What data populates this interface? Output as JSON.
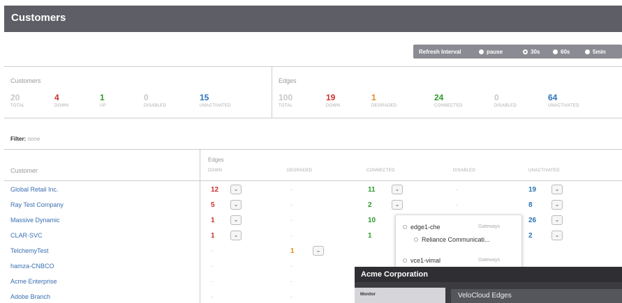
{
  "header": {
    "title": "Customers"
  },
  "refresh": {
    "label": "Refresh Interval",
    "options": [
      {
        "label": "pause",
        "selected": false
      },
      {
        "label": "30s",
        "selected": true
      },
      {
        "label": "60s",
        "selected": false
      },
      {
        "label": "5min",
        "selected": false
      }
    ]
  },
  "summary": {
    "customers_label": "Customers",
    "edges_label": "Edges",
    "customers": [
      {
        "value": "20",
        "caption": "TOTAL",
        "color": "#c8c8c8"
      },
      {
        "value": "4",
        "caption": "DOWN",
        "color": "#c9302c"
      },
      {
        "value": "1",
        "caption": "UP",
        "color": "#2c9a2c"
      },
      {
        "value": "0",
        "caption": "DISABLED",
        "color": "#c8c8c8"
      },
      {
        "value": "15",
        "caption": "UNACTIVATED",
        "color": "#2a73b8"
      }
    ],
    "edges": [
      {
        "value": "100",
        "caption": "TOTAL",
        "color": "#c8c8c8"
      },
      {
        "value": "19",
        "caption": "DOWN",
        "color": "#c9302c"
      },
      {
        "value": "1",
        "caption": "DEGRADED",
        "color": "#e08a1e"
      },
      {
        "value": "24",
        "caption": "CONNECTED",
        "color": "#2c9a2c"
      },
      {
        "value": "0",
        "caption": "DISABLED",
        "color": "#c8c8c8"
      },
      {
        "value": "64",
        "caption": "UNACTIVATED",
        "color": "#2a73b8"
      }
    ]
  },
  "filter": {
    "label": "Filter:",
    "value": "none"
  },
  "table": {
    "customer_header": "Customer",
    "edges_header": "Edges",
    "sub_headers": [
      "DOWN",
      "DEGRADED",
      "CONNECTED",
      "DISABLED",
      "UNACTIVATED"
    ],
    "rows": [
      {
        "name": "Global Retail Inc.",
        "down": "12",
        "degraded": "",
        "connected": "11",
        "unactivated": "19"
      },
      {
        "name": "Ray Test Company",
        "down": "5",
        "degraded": "",
        "connected": "2",
        "unactivated": "8"
      },
      {
        "name": "Massive Dynamic",
        "down": "1",
        "degraded": "",
        "connected": "10",
        "unactivated": "26"
      },
      {
        "name": "CLAR-SVC",
        "down": "1",
        "degraded": "",
        "connected": "1",
        "unactivated": "2"
      },
      {
        "name": "TelchemyTest",
        "down": "",
        "degraded": "1",
        "connected": "",
        "unactivated": ""
      },
      {
        "name": "hamza-CNBCO",
        "down": "",
        "degraded": "",
        "connected": "",
        "unactivated": ""
      },
      {
        "name": "Acme Enterprise",
        "down": "",
        "degraded": "",
        "connected": "",
        "unactivated": ""
      },
      {
        "name": "Adobe Branch",
        "down": "",
        "degraded": "",
        "connected": "",
        "unactivated": ""
      }
    ]
  },
  "popover": {
    "item1": "edge1-che",
    "item1_tag": "Gateways",
    "item1_sub": "Reliance Communicati...",
    "item2": "vce1-vimal",
    "item2_tag": "Gateways"
  },
  "overlay": {
    "title": "Acme Corporation",
    "nav_label": "Monitor",
    "panel_title": "VeloCloud Edges"
  }
}
